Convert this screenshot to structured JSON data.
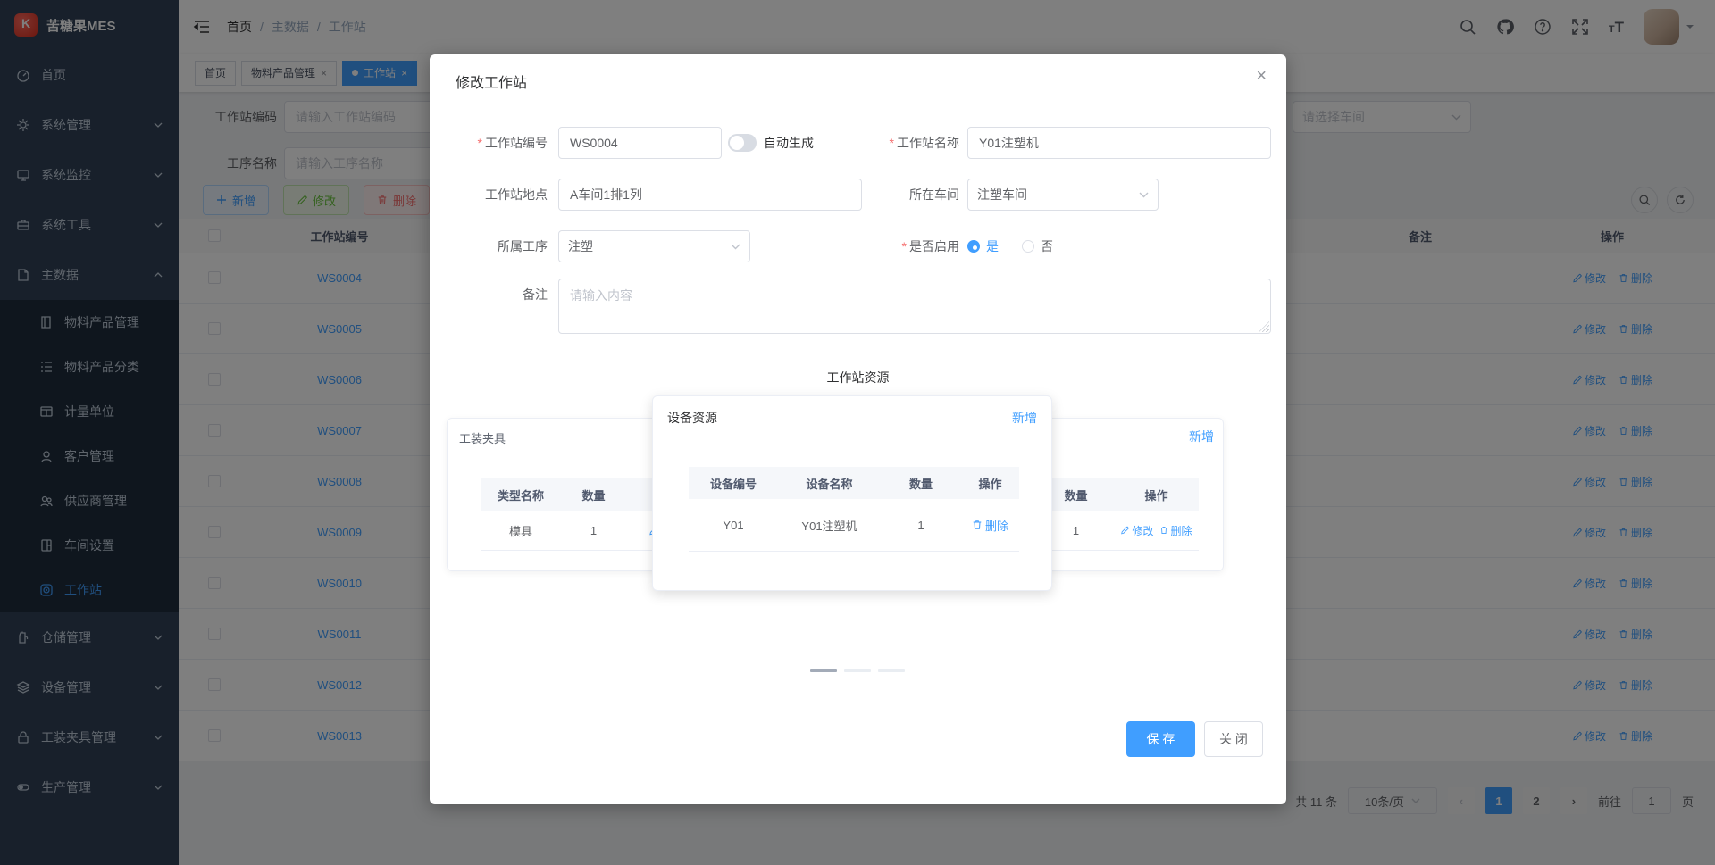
{
  "app": {
    "title": "苦糖果MES"
  },
  "sidebar": {
    "items_top": [
      {
        "label": "首页",
        "icon": "dashboard-icon"
      },
      {
        "label": "系统管理",
        "icon": "gear-icon"
      },
      {
        "label": "系统监控",
        "icon": "monitor-icon"
      },
      {
        "label": "系统工具",
        "icon": "toolbox-icon"
      },
      {
        "label": "主数据",
        "icon": "document-icon"
      }
    ],
    "sub": [
      {
        "label": "物料产品管理",
        "icon": "book-icon"
      },
      {
        "label": "物料产品分类",
        "icon": "category-icon"
      },
      {
        "label": "计量单位",
        "icon": "unit-icon"
      },
      {
        "label": "客户管理",
        "icon": "customer-icon"
      },
      {
        "label": "供应商管理",
        "icon": "supplier-icon"
      },
      {
        "label": "车间设置",
        "icon": "workshop-icon"
      },
      {
        "label": "工作站",
        "icon": "station-icon"
      }
    ],
    "items_bottom": [
      {
        "label": "仓储管理",
        "icon": "warehouse-icon"
      },
      {
        "label": "设备管理",
        "icon": "device-icon"
      },
      {
        "label": "工装夹具管理",
        "icon": "lock-icon"
      },
      {
        "label": "生产管理",
        "icon": "production-icon"
      }
    ]
  },
  "header": {
    "breadcrumb": [
      "首页",
      "主数据",
      "工作站"
    ],
    "separator": "/"
  },
  "tabs": [
    {
      "label": "首页"
    },
    {
      "label": "物料产品管理"
    },
    {
      "label": "工作站"
    }
  ],
  "filters": {
    "code_label": "工作站编码",
    "code_placeholder": "请输入工作站编码",
    "process_label": "工序名称",
    "process_placeholder": "请输入工序名称",
    "workshop_placeholder": "请选择车间"
  },
  "toolbar": {
    "add": "新增",
    "edit": "修改",
    "delete": "删除",
    "export": ""
  },
  "table": {
    "headers": {
      "code": "工作站编号",
      "remark": "备注",
      "ops": "操作"
    },
    "row_edit": "修改",
    "row_delete": "删除",
    "rows": [
      {
        "code": "WS0004"
      },
      {
        "code": "WS0005"
      },
      {
        "code": "WS0006"
      },
      {
        "code": "WS0007"
      },
      {
        "code": "WS0008"
      },
      {
        "code": "WS0009"
      },
      {
        "code": "WS0010"
      },
      {
        "code": "WS0011"
      },
      {
        "code": "WS0012"
      },
      {
        "code": "WS0013"
      }
    ]
  },
  "pagination": {
    "total": "共 11 条",
    "page_size": "10条/页",
    "pages": [
      "1",
      "2"
    ],
    "goto_label": "前往",
    "goto_value": "1",
    "unit": "页"
  },
  "modal": {
    "title": "修改工作站",
    "close": "×",
    "star": "*",
    "fields": {
      "code_label": "工作站编号",
      "code_value": "WS0004",
      "auto_generate": "自动生成",
      "name_label": "工作站名称",
      "name_value": "Y01注塑机",
      "location_label": "工作站地点",
      "location_value": "A车间1排1列",
      "workshop_label": "所在车间",
      "workshop_value": "注塑车间",
      "process_label": "所属工序",
      "process_value": "注塑",
      "enabled_label": "是否启用",
      "enabled_yes": "是",
      "enabled_no": "否",
      "remark_label": "备注",
      "remark_placeholder": "请输入内容"
    },
    "resources": {
      "section_title": "工作站资源",
      "fixtures": {
        "title": "工装夹具",
        "col_type": "类型名称",
        "col_qty": "数量",
        "row_type": "模具",
        "row_qty": "1"
      },
      "equipment": {
        "title": "设备资源",
        "add": "新增",
        "col_code": "设备编号",
        "col_name": "设备名称",
        "col_qty": "数量",
        "col_ops": "操作",
        "row_code": "Y01",
        "row_name": "Y01注塑机",
        "row_qty": "1",
        "delete": "删除"
      },
      "extra": {
        "add": "新增",
        "col_qty": "数量",
        "col_ops": "操作",
        "row_qty": "1",
        "edit": "修改",
        "delete": "删除"
      }
    },
    "footer": {
      "save": "保 存",
      "close": "关 闭"
    }
  }
}
